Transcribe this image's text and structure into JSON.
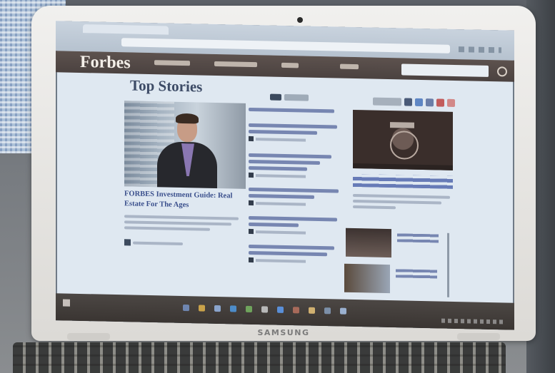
{
  "laptop": {
    "brand": "SAMSUNG"
  },
  "site": {
    "logo": "Forbes",
    "section_title": "Top Stories",
    "lead_headline": "FORBES Investment Guide: Real Estate For The Ages"
  },
  "colors": {
    "nav_bar": "#4b4240",
    "link_blue": "#3a4f8c",
    "screen_bg": "#dfe8f1",
    "taskbar": "#3a3532"
  },
  "icons": [
    "search-icon",
    "play-video-icon",
    "share-icons",
    "windows-start-icon"
  ]
}
